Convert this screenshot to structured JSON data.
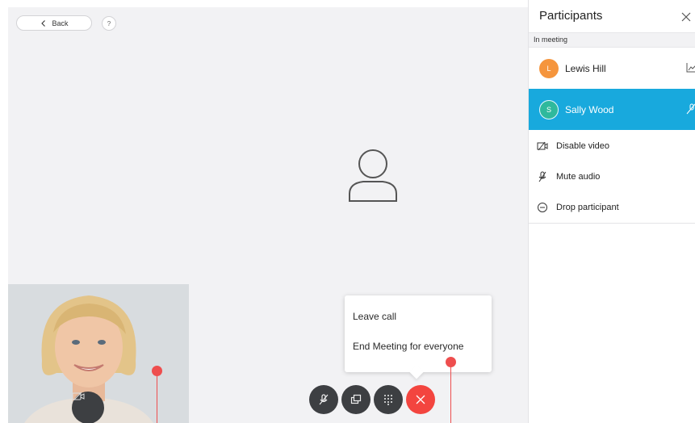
{
  "stage": {
    "back_label": "Back",
    "help_glyph": "?"
  },
  "controls": {
    "icons": [
      "microphone-muted-icon",
      "share-screen-icon",
      "keypad-icon",
      "end-call-icon"
    ],
    "end_call_color": "#f3453f"
  },
  "leave_menu": {
    "items": [
      "Leave call",
      "End Meeting for everyone"
    ]
  },
  "panel": {
    "title": "Participants",
    "section": "In meeting",
    "participants": [
      {
        "initial": "L",
        "name": "Lewis Hill",
        "avatar_color": "#f5953d",
        "selected": false
      },
      {
        "initial": "S",
        "name": "Sally Wood",
        "avatar_color": "#2fb99c",
        "selected": true
      }
    ],
    "actions": [
      {
        "label": "Disable video",
        "icon": "video-off-icon"
      },
      {
        "label": "Mute audio",
        "icon": "microphone-muted-icon"
      },
      {
        "label": "Drop participant",
        "icon": "minus-circle-icon"
      }
    ]
  },
  "colors": {
    "accent": "#18a9dd",
    "annotation": "#ee4e4e"
  }
}
